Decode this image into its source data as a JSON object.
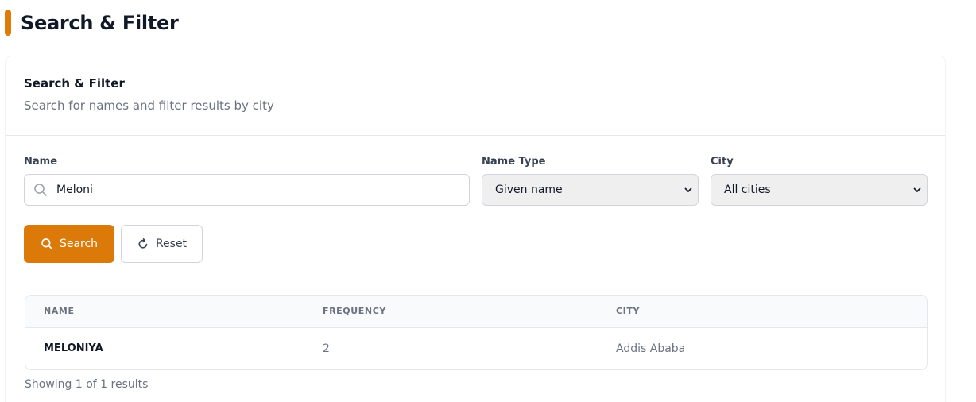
{
  "page": {
    "title": "Search & Filter"
  },
  "card": {
    "title": "Search & Filter",
    "subtitle": "Search for names and filter results by city"
  },
  "form": {
    "name_label": "Name",
    "name_value": "Meloni",
    "name_type_label": "Name Type",
    "name_type_value": "Given name",
    "city_label": "City",
    "city_value": "All cities",
    "search_label": "Search",
    "reset_label": "Reset"
  },
  "table": {
    "columns": [
      "NAME",
      "FREQUENCY",
      "CITY"
    ],
    "rows": [
      {
        "name": "MELONIYA",
        "frequency": "2",
        "city": "Addis Ababa"
      }
    ]
  },
  "results_text": "Showing 1 of 1 results",
  "colors": {
    "accent": "#dc7a09",
    "muted_text": "#6b7280",
    "border": "#d1d5db"
  },
  "icons": {
    "search_input": "search-icon",
    "select": "chevron-down-icon",
    "search_button": "search-icon",
    "reset_button": "refresh-icon"
  }
}
